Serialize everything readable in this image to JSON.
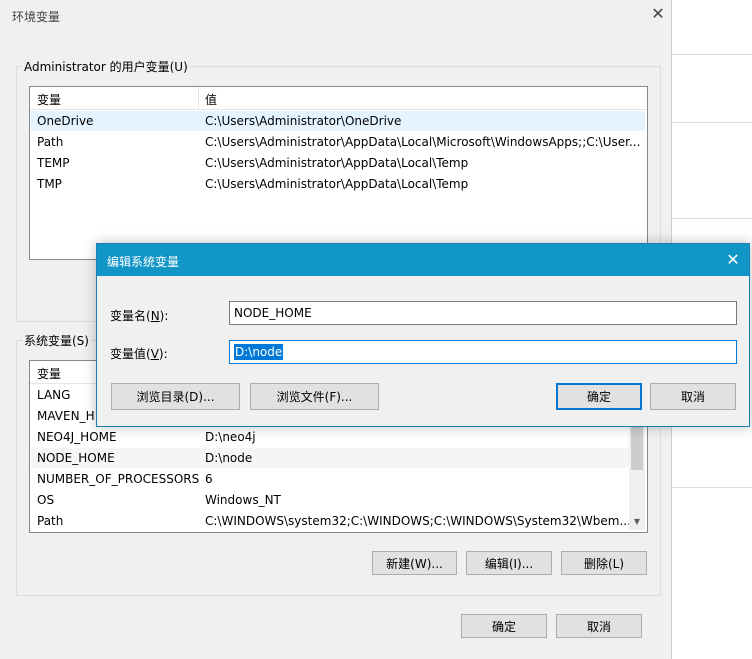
{
  "window": {
    "title": "环境变量",
    "close_glyph": "✕"
  },
  "user_vars": {
    "group_title": "Administrator 的用户变量(U)",
    "col_var": "变量",
    "col_val": "值",
    "rows": [
      {
        "name": "OneDrive",
        "value": "C:\\Users\\Administrator\\OneDrive"
      },
      {
        "name": "Path",
        "value": "C:\\Users\\Administrator\\AppData\\Local\\Microsoft\\WindowsApps;;C:\\User..."
      },
      {
        "name": "TEMP",
        "value": "C:\\Users\\Administrator\\AppData\\Local\\Temp"
      },
      {
        "name": "TMP",
        "value": "C:\\Users\\Administrator\\AppData\\Local\\Temp"
      }
    ]
  },
  "sys_vars": {
    "group_title": "系统变量(S)",
    "col_var": "变量",
    "rows": [
      {
        "name": "LANG",
        "value": ""
      },
      {
        "name": "MAVEN_H",
        "value": ""
      },
      {
        "name": "NEO4J_HOME",
        "value": "D:\\neo4j"
      },
      {
        "name": "NODE_HOME",
        "value": "D:\\node"
      },
      {
        "name": "NUMBER_OF_PROCESSORS",
        "value": "6"
      },
      {
        "name": "OS",
        "value": "Windows_NT"
      },
      {
        "name": "Path",
        "value": "C:\\WINDOWS\\system32;C:\\WINDOWS;C:\\WINDOWS\\System32\\Wbem..."
      }
    ],
    "new_label": "新建(W)...",
    "edit_label": "编辑(I)...",
    "delete_label": "删除(L)"
  },
  "footer": {
    "ok_label": "确定",
    "cancel_label": "取消"
  },
  "edit_dialog": {
    "title": "编辑系统变量",
    "close_glyph": "✕",
    "name_label_prefix": "变量名(",
    "name_label_key": "N",
    "name_label_suffix": "):",
    "name_value": "NODE_HOME",
    "value_label_prefix": "变量值(",
    "value_label_key": "V",
    "value_label_suffix": "):",
    "value_value": "D:\\node",
    "browse_dir_label": "浏览目录(D)...",
    "browse_file_label": "浏览文件(F)...",
    "ok_label": "确定",
    "cancel_label": "取消"
  },
  "colors": {
    "dialog_title_bg": "#1296c8",
    "selection": "#0078d7"
  }
}
